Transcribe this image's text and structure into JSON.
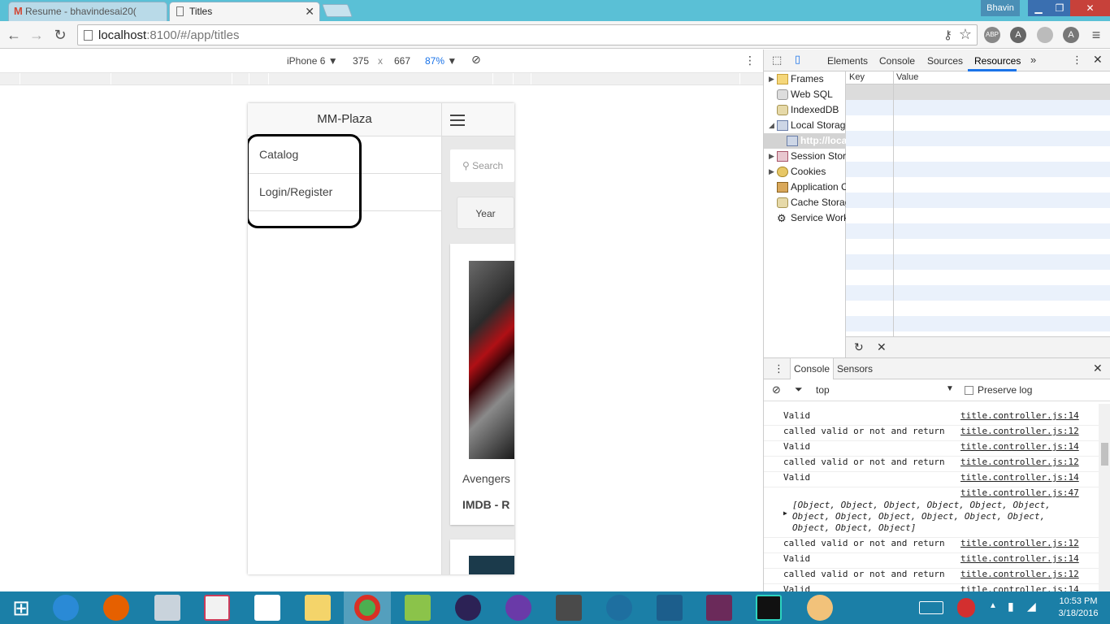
{
  "browser": {
    "tabs": [
      {
        "title": "Resume - bhavindesai20(",
        "icon": "gmail-icon",
        "active": false
      },
      {
        "title": "Titles",
        "icon": "page-icon",
        "active": true
      }
    ],
    "user": "Bhavin",
    "url_host": "localhost",
    "url_rest": ":8100/#/app/titles",
    "extensions": [
      "ABP"
    ]
  },
  "devmode": {
    "device": "iPhone 6",
    "width": "375",
    "times": "x",
    "height": "667",
    "zoom": "87%"
  },
  "app": {
    "menu_title": "MM-Plaza",
    "menu_items": [
      "Catalog",
      "Login/Register"
    ],
    "search_placeholder": "Search",
    "year_button": "Year",
    "card_title": "Avengers",
    "card_sub": "IMDB - R"
  },
  "devtools": {
    "tabs": [
      "Elements",
      "Console",
      "Sources",
      "Resources"
    ],
    "active_tab": "Resources",
    "tree": [
      {
        "label": "Frames",
        "icon": "folder-icon",
        "arrow": "▶"
      },
      {
        "label": "Web SQL",
        "icon": "database-icon",
        "arrow": ""
      },
      {
        "label": "IndexedDB",
        "icon": "database-icon",
        "arrow": ""
      },
      {
        "label": "Local Storage",
        "icon": "grid-icon",
        "arrow": "◢"
      },
      {
        "label": "http://loca",
        "icon": "grid-icon",
        "arrow": "",
        "selected": true
      },
      {
        "label": "Session Storage",
        "icon": "grid-icon",
        "arrow": "▶"
      },
      {
        "label": "Cookies",
        "icon": "cookie-icon",
        "arrow": "▶"
      },
      {
        "label": "Application Cache",
        "icon": "appcache-icon",
        "arrow": ""
      },
      {
        "label": "Cache Storage",
        "icon": "database-icon",
        "arrow": ""
      },
      {
        "label": "Service Workers",
        "icon": "gear-icon",
        "arrow": ""
      }
    ],
    "kv_headers": {
      "key": "Key",
      "value": "Value"
    },
    "drawer_tabs": [
      "Console",
      "Sensors"
    ],
    "filter_context": "top",
    "preserve_log": "Preserve log",
    "console": [
      {
        "msg": "Valid",
        "src": "title.controller.js:14"
      },
      {
        "msg": "called valid or not and return",
        "src": "title.controller.js:12"
      },
      {
        "msg": "Valid",
        "src": "title.controller.js:14"
      },
      {
        "msg": "called valid or not and return",
        "src": "title.controller.js:12"
      },
      {
        "msg": "Valid",
        "src": "title.controller.js:14"
      },
      {
        "msg": "",
        "src": "title.controller.js:47",
        "object": "[Object, Object, Object, Object, Object, Object, Object, Object, Object, Object, Object, Object, Object, Object, Object]"
      },
      {
        "msg": "called valid or not and return",
        "src": "title.controller.js:12"
      },
      {
        "msg": "Valid",
        "src": "title.controller.js:14"
      },
      {
        "msg": "called valid or not and return",
        "src": "title.controller.js:12"
      },
      {
        "msg": "Valid",
        "src": "title.controller.js:14"
      }
    ]
  },
  "taskbar": {
    "time": "10:53 PM",
    "date": "3/18/2016",
    "apps": [
      "start",
      "internet-explorer",
      "firefox",
      "database-tool",
      "slack",
      "dropbox",
      "file-explorer",
      "chrome",
      "notepad-plus",
      "eclipse",
      "eclipse-ee",
      "sublime-text",
      "sourcetree",
      "mysql-workbench",
      "java-ee-ide",
      "webstorm",
      "paint"
    ]
  },
  "colors": {
    "tabstrip": "#5ac0d6",
    "taskbar": "#1b7fa7",
    "devtools_accent": "#1a73e8"
  }
}
